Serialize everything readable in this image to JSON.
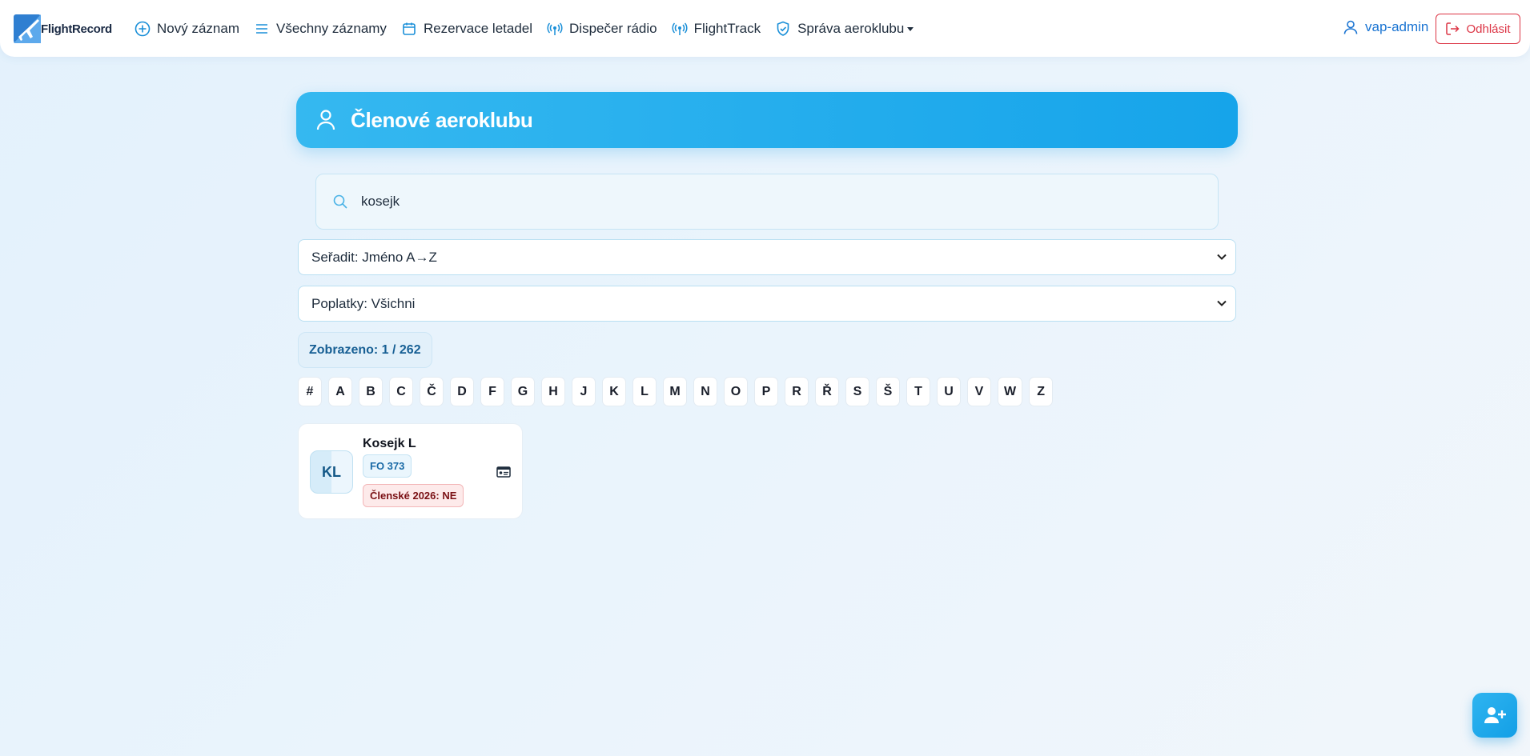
{
  "brand": {
    "name": "FlightRecord"
  },
  "nav": {
    "items": [
      {
        "label": "Nový záznam",
        "icon": "plus-circle-icon"
      },
      {
        "label": "Všechny záznamy",
        "icon": "list-icon"
      },
      {
        "label": "Rezervace letadel",
        "icon": "calendar-icon"
      },
      {
        "label": "Dispečer rádio",
        "icon": "broadcast-icon"
      },
      {
        "label": "FlightTrack",
        "icon": "broadcast-icon"
      },
      {
        "label": "Správa aeroklubu",
        "icon": "shield-icon",
        "dropdown": true
      }
    ],
    "user": "vap-admin",
    "logout": "Odhlásit"
  },
  "page": {
    "title": "Členové aeroklubu",
    "search": {
      "value": "kosejk",
      "placeholder": ""
    },
    "sort_select": "Seřadit: Jméno A→Z",
    "fee_select": "Poplatky: Všichni",
    "count": "Zobrazeno: 1 / 262",
    "letters": [
      "#",
      "A",
      "B",
      "C",
      "Č",
      "D",
      "F",
      "G",
      "H",
      "J",
      "K",
      "L",
      "M",
      "N",
      "O",
      "P",
      "R",
      "Ř",
      "S",
      "Š",
      "T",
      "U",
      "V",
      "W",
      "Z"
    ]
  },
  "members": [
    {
      "initials": "KL",
      "name": "Kosejk L",
      "code": "FO 373",
      "fee": "Členské 2026: NE"
    }
  ],
  "colors": {
    "accent": "#16a4ea",
    "link": "#1a74d2",
    "danger": "#dc3545"
  }
}
